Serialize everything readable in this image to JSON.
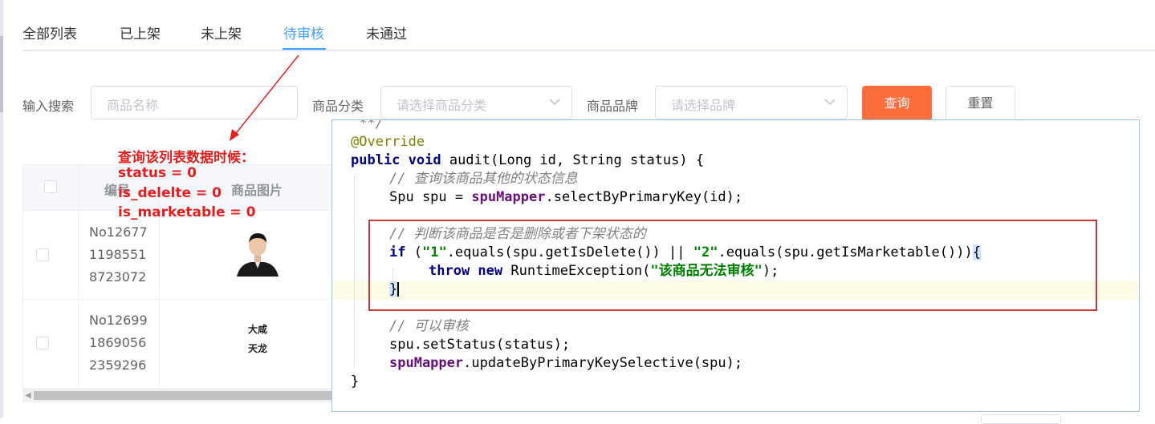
{
  "tabs": [
    {
      "label": "全部列表"
    },
    {
      "label": "已上架"
    },
    {
      "label": "未上架"
    },
    {
      "label": "待审核"
    },
    {
      "label": "未通过"
    }
  ],
  "active_tab": "待审核",
  "search": {
    "keyword_label": "输入搜索",
    "keyword_placeholder": "商品名称",
    "category_label": "商品分类",
    "category_placeholder": "请选择商品分类",
    "brand_label": "商品品牌",
    "brand_placeholder": "请选择品牌",
    "query_button": "查询",
    "reset_button": "重置"
  },
  "table": {
    "headers": [
      "编号",
      "商品图片"
    ],
    "rows": [
      {
        "id_lines": [
          "No12677",
          "1198551",
          "8723072"
        ],
        "image": "portrait-photo"
      },
      {
        "id_lines": [
          "No12699",
          "1869056",
          "2359296"
        ],
        "image_text": [
          "大咸",
          "天龙"
        ]
      }
    ]
  },
  "annotation": {
    "title": "查询该列表数据时候：",
    "lines": [
      "status = 0",
      "is_delelte = 0",
      "is_marketable = 0"
    ],
    "color": "#e02020"
  },
  "code": {
    "l00": " **/",
    "l01": "@Override",
    "l02a": "public void",
    "l02b": " audit(Long id, String status) {",
    "l03": "// 查询该商品其他的状态信息",
    "l04a": "Spu spu = ",
    "l04b": "spuMapper",
    "l04c": ".selectByPrimaryKey(id);",
    "l06": "// 判断该商品是否是删除或者下架状态的",
    "l07a": "if",
    "l07b": " (",
    "l07c": "\"1\"",
    "l07d": ".equals(spu.getIsDelete()) || ",
    "l07e": "\"2\"",
    "l07f": ".equals(spu.getIsMarketable()))",
    "l07g": "{",
    "l08a": "throw new",
    "l08b": " RuntimeException(",
    "l08c": "\"该商品无法审核\"",
    "l08d": ");",
    "l09": "}",
    "l11": "// 可以审核",
    "l12": "spu.setStatus(status);",
    "l13a": "spuMapper",
    "l13b": ".updateByPrimaryKeySelective(spu);",
    "l14": "}"
  },
  "colors": {
    "primary_button": "#ff6d3a",
    "active_tab": "#409eff",
    "highlight_box": "#c83737",
    "popup_border": "#99c4ee"
  }
}
